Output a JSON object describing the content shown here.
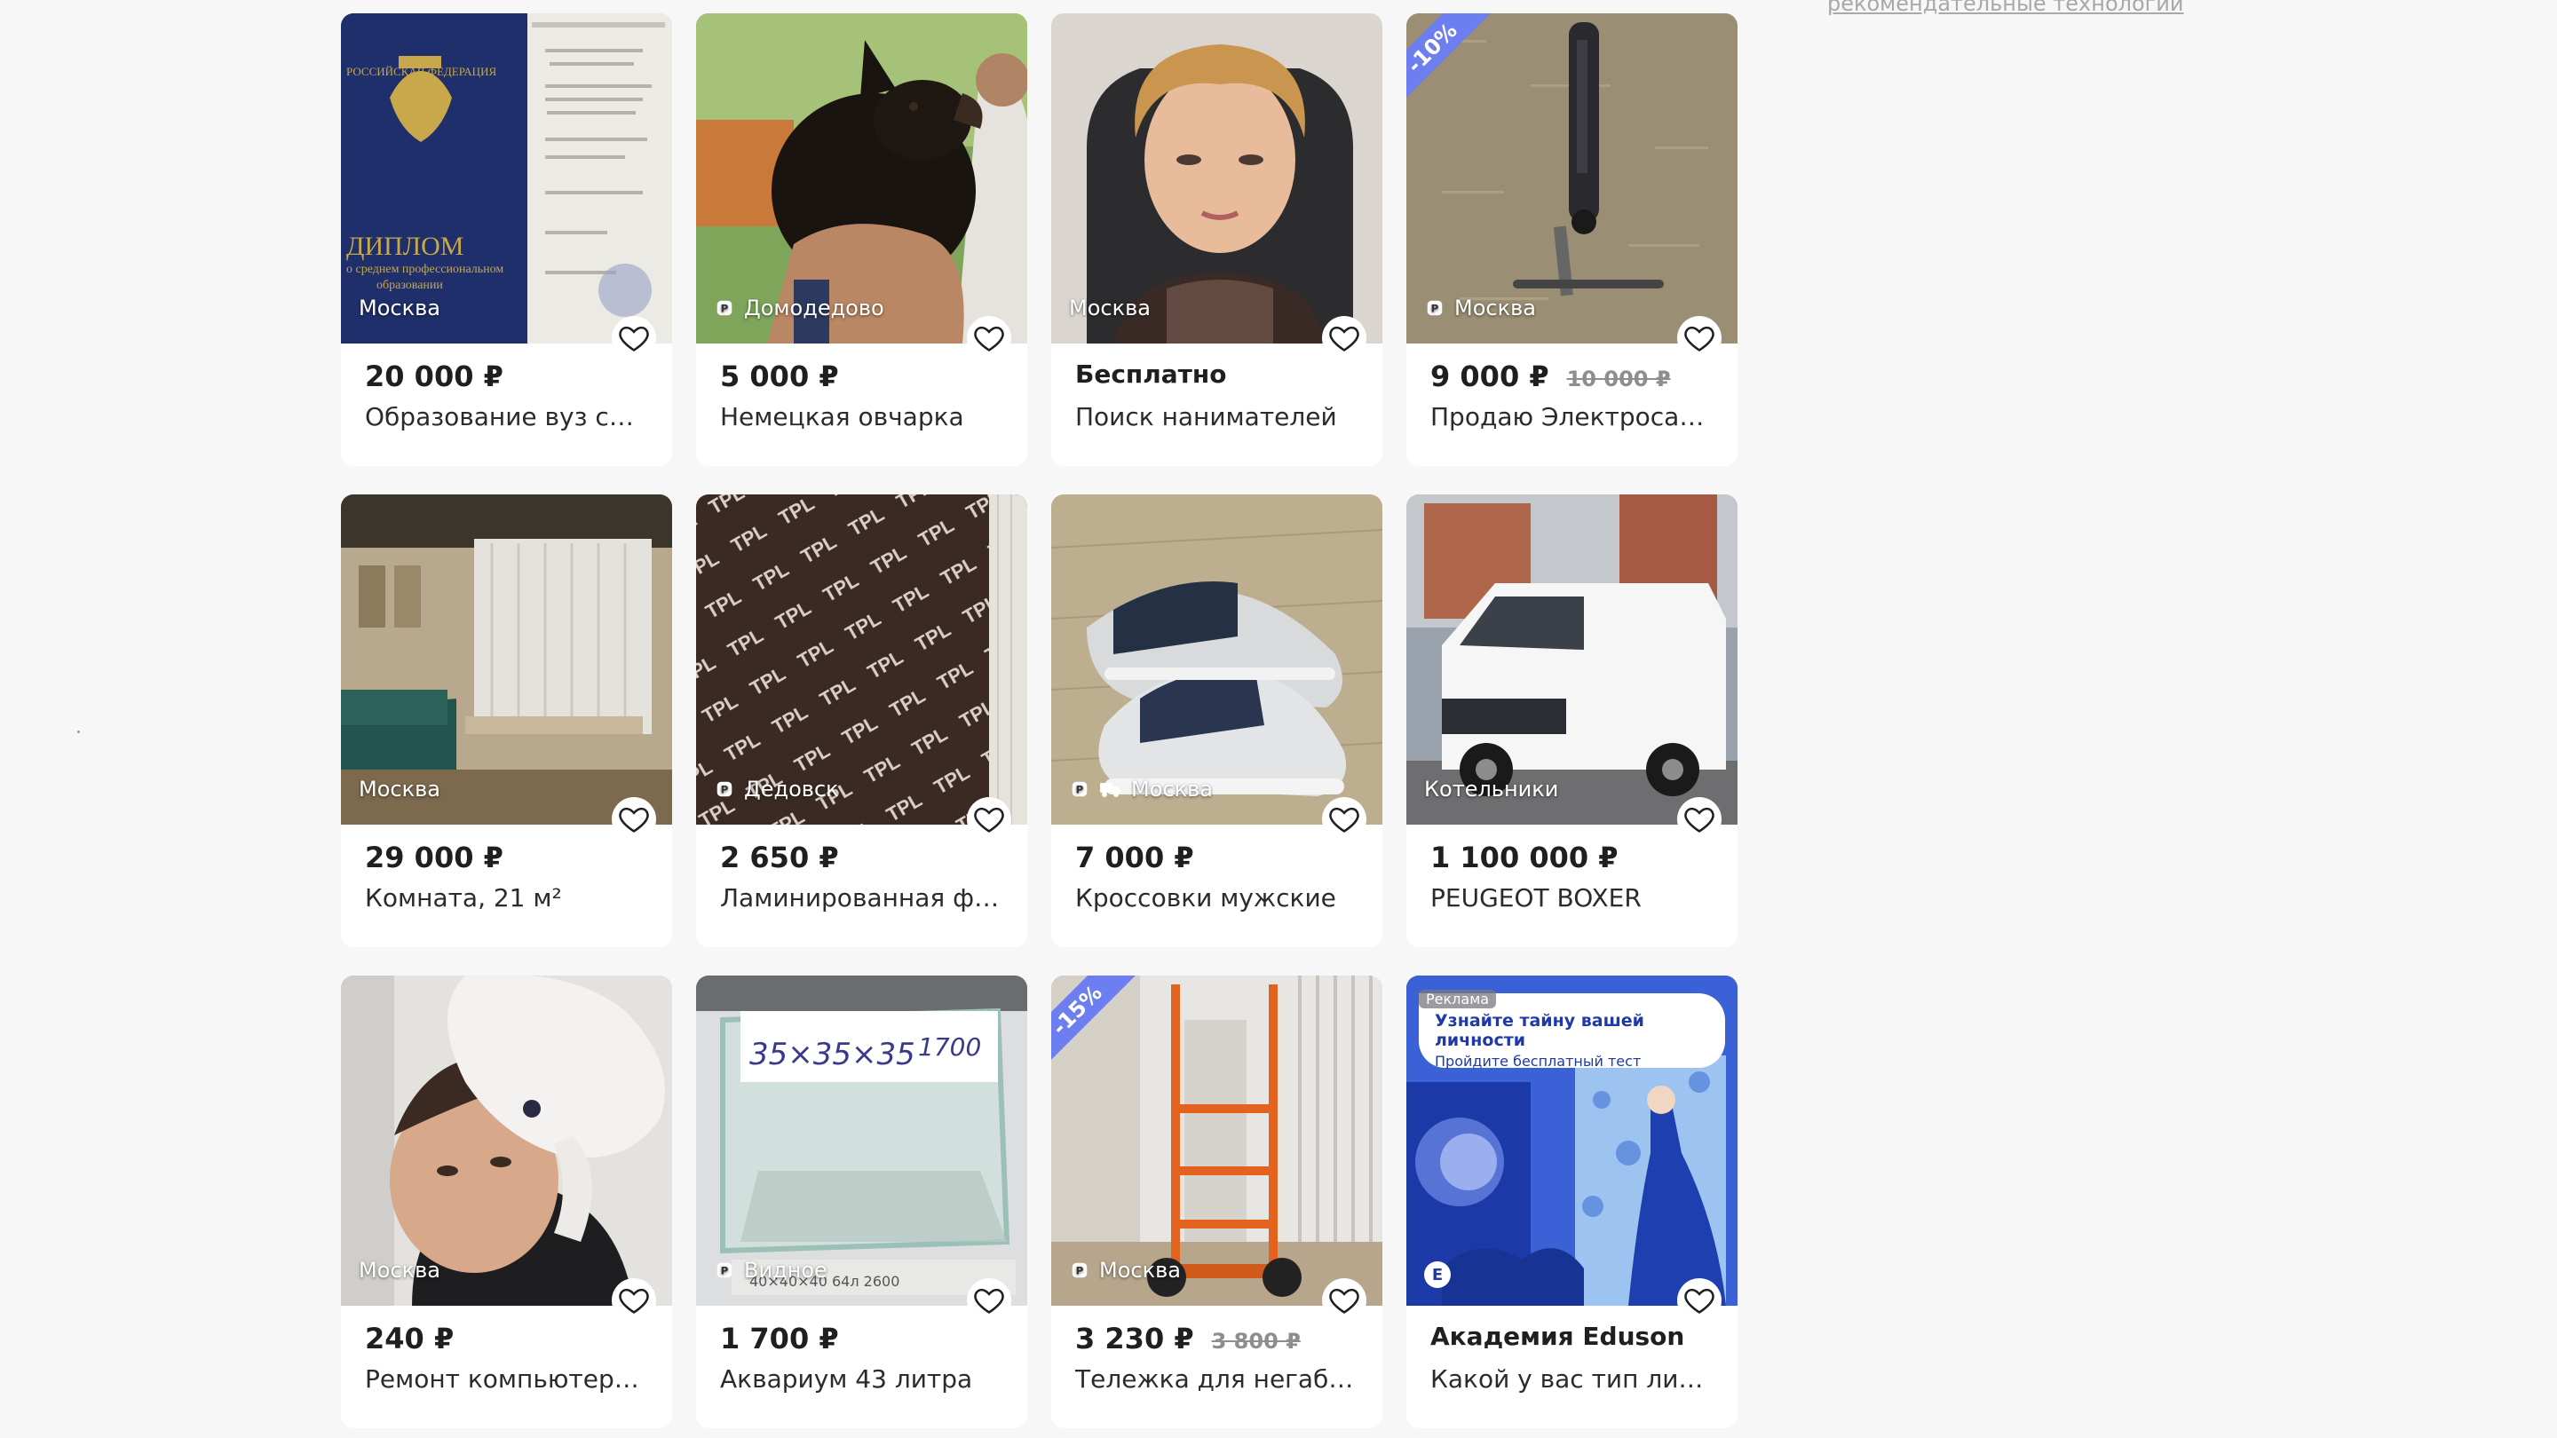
{
  "side_link": "рекомендательные технологии",
  "colors": {
    "discount": "#6d7ef0",
    "price": "#1f1f1f",
    "page_bg": "#f7f7f7"
  },
  "listings": [
    {
      "price": "20 000 ₽",
      "title": "Образование вуз спо ...",
      "location": "Москва",
      "photo": "diploma"
    },
    {
      "price": "5 000 ₽",
      "title": "Немецкая овчарка",
      "location": "Домодедово",
      "verified": true,
      "photo": "puppy"
    },
    {
      "price": "Бесплатно",
      "title": "Поиск нанимателей",
      "location": "Москва",
      "photo": "woman-portrait"
    },
    {
      "price": "9 000 ₽",
      "old_price": "10 000 ₽",
      "discount": "-10%",
      "title": "Продаю Электросамо...",
      "location": "Москва",
      "verified": true,
      "photo": "scooter"
    },
    {
      "price": "29 000 ₽",
      "title": "Комната, 21 м²",
      "location": "Москва",
      "photo": "room"
    },
    {
      "price": "2 650 ₽",
      "title": "Ламинированная фан...",
      "location": "Дедовск",
      "verified": true,
      "photo": "plywood"
    },
    {
      "price": "7 000 ₽",
      "title": "Кроссовки мужские",
      "location": "Москва",
      "verified": true,
      "delivery": true,
      "photo": "sneakers"
    },
    {
      "price": "1 100 000 ₽",
      "title": "PEUGEOT BOXER",
      "location": "Котельники",
      "photo": "van"
    },
    {
      "price": "240 ₽",
      "title": "Ремонт компьютеров...",
      "location": "Москва",
      "photo": "man-with-cat"
    },
    {
      "price": "1 700 ₽",
      "title": "Аквариум 43 литра",
      "location": "Видное",
      "verified": true,
      "photo": "aquarium"
    },
    {
      "price": "3 230 ₽",
      "old_price": "3 800 ₽",
      "discount": "-15%",
      "title": "Тележка для негабар...",
      "location": "Москва",
      "verified": true,
      "photo": "hand-truck"
    },
    {
      "price": "Академия Eduson",
      "title": "Какой у вас тип личн...",
      "ad": true,
      "ad_label": "Реклама",
      "ad_headline": "Узнайте тайну вашей личности",
      "ad_subline": "Пройдите бесплатный тест",
      "brand_letter": "E",
      "photo": "ad-illustration"
    }
  ]
}
